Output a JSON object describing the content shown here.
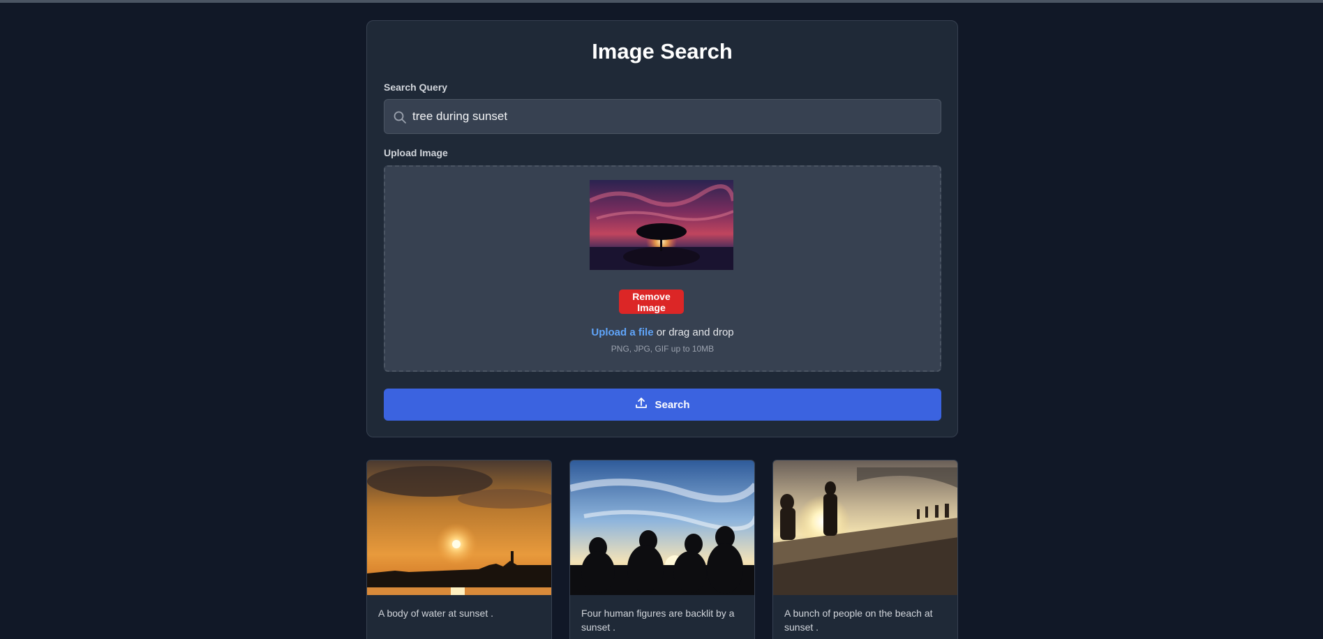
{
  "header": {
    "title": "Image Search"
  },
  "search": {
    "label": "Search Query",
    "value": "tree during sunset",
    "icon": "search-icon"
  },
  "upload": {
    "label": "Upload Image",
    "remove_label": "Remove Image",
    "link_text": "Upload a file",
    "drag_text": " or drag and drop",
    "hint": "PNG, JPG, GIF up to 10MB"
  },
  "actions": {
    "search_label": "Search",
    "search_icon": "upload-icon"
  },
  "colors": {
    "background": "#111827",
    "panel": "#1f2937",
    "primary": "#3b63e0",
    "danger": "#dc2626",
    "link": "#60a5fa"
  },
  "results": [
    {
      "caption": "A body of water at sunset ."
    },
    {
      "caption": "Four human figures are backlit by a sunset ."
    },
    {
      "caption": "A bunch of people on the beach at sunset ."
    }
  ]
}
